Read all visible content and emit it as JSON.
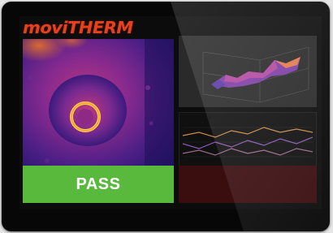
{
  "brand": {
    "logo_text": "moviTHERM"
  },
  "result": {
    "pass_label": "PASS",
    "pass_color": "#58b93c",
    "fail_color": "#3a0d0f"
  },
  "colors": {
    "brand": "#e8401c",
    "bezel": "#070707"
  },
  "icons": {
    "thermal_view": "thermal-image",
    "surface_plot": "3d-surface-plot",
    "trend_plot": "line-trend-plot"
  }
}
